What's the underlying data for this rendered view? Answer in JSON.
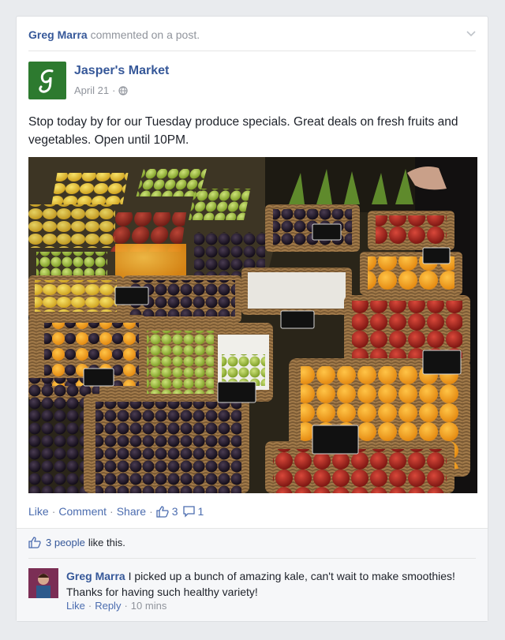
{
  "story": {
    "actor": "Greg Marra",
    "action": "commented on a post."
  },
  "post": {
    "page_name": "Jasper's Market",
    "date": "April 21",
    "date_sep": "·",
    "text": "Stop today by for our Tuesday produce specials. Great deals on fresh fruits and vegetables. Open until 10PM.",
    "photo_signs": [
      "",
      "",
      ""
    ]
  },
  "actions": {
    "like": "Like",
    "comment": "Comment",
    "share": "Share",
    "sep": "·",
    "like_count": "3",
    "comment_count": "1"
  },
  "ufi": {
    "likes_link": "3 people",
    "likes_suffix": "like this.",
    "comment": {
      "author": "Greg Marra",
      "text": "I picked up a bunch of amazing kale, can't wait to make smoothies! Thanks for having such healthy variety!",
      "like": "Like",
      "reply": "Reply",
      "sep": "·",
      "time": "10 mins"
    }
  },
  "colors": {
    "link": "#365899",
    "meta": "#90949c",
    "page_logo": "#2d7a2f"
  }
}
